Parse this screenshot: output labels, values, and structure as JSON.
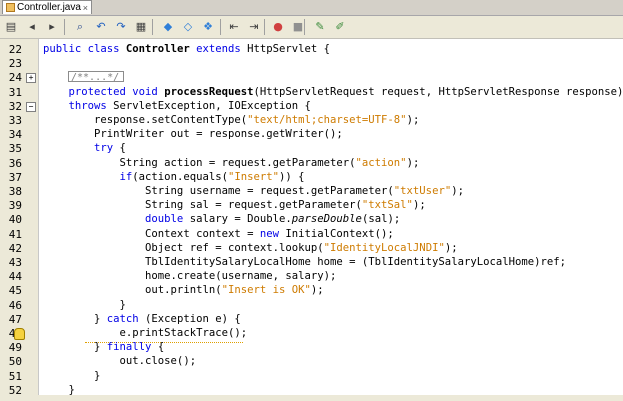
{
  "tab": {
    "title": "Controller.java",
    "close": "×"
  },
  "toolbar": {
    "icons": [
      "history-icon",
      "back-icon",
      "forward-icon",
      "search-icon",
      "find-previous-icon",
      "find-next-icon",
      "toggle-highlight-icon",
      "prev-bookmark-icon",
      "next-bookmark-icon",
      "toggle-bookmark-icon",
      "shift-left-icon",
      "shift-right-icon",
      "record-macro-icon",
      "stop-macro-icon",
      "comment-icon",
      "uncomment-icon"
    ]
  },
  "editor": {
    "line_numbers": [
      "22",
      "23",
      "24",
      "31",
      "32",
      "33",
      "34",
      "35",
      "36",
      "37",
      "38",
      "39",
      "40",
      "41",
      "42",
      "43",
      "44",
      "45",
      "46",
      "47",
      "48",
      "49",
      "50",
      "51",
      "52"
    ],
    "collapsed_text": "/**...*/",
    "lines": [
      [
        {
          "t": "public class ",
          "c": "kw"
        },
        {
          "t": "Controller",
          "c": "b"
        },
        {
          "t": " ",
          "c": ""
        },
        {
          "t": "extends",
          "c": "kw"
        },
        {
          "t": " HttpServlet {",
          "c": ""
        }
      ],
      [],
      [],
      [
        {
          "t": "    protected void ",
          "c": "kw"
        },
        {
          "t": "processRequest",
          "c": "b"
        },
        {
          "t": "(HttpServletRequest request, HttpServletResponse response)",
          "c": ""
        }
      ],
      [
        {
          "t": "    throws",
          "c": "kw"
        },
        {
          "t": " ServletException, IOException {",
          "c": ""
        }
      ],
      [
        {
          "t": "        response.setContentType(",
          "c": ""
        },
        {
          "t": "\"text/html;charset=UTF-8\"",
          "c": "st"
        },
        {
          "t": ");",
          "c": ""
        }
      ],
      [
        {
          "t": "        PrintWriter out = response.getWriter();",
          "c": ""
        }
      ],
      [
        {
          "t": "        try",
          "c": "kw"
        },
        {
          "t": " {",
          "c": ""
        }
      ],
      [
        {
          "t": "            String action = request.getParameter(",
          "c": ""
        },
        {
          "t": "\"action\"",
          "c": "st"
        },
        {
          "t": ");",
          "c": ""
        }
      ],
      [
        {
          "t": "            if",
          "c": "kw"
        },
        {
          "t": "(action.equals(",
          "c": ""
        },
        {
          "t": "\"Insert\"",
          "c": "st"
        },
        {
          "t": ")) {",
          "c": ""
        }
      ],
      [
        {
          "t": "                String username = request.getParameter(",
          "c": ""
        },
        {
          "t": "\"txtUser\"",
          "c": "st"
        },
        {
          "t": ");",
          "c": ""
        }
      ],
      [
        {
          "t": "                String sal = request.getParameter(",
          "c": ""
        },
        {
          "t": "\"txtSal\"",
          "c": "st"
        },
        {
          "t": ");",
          "c": ""
        }
      ],
      [
        {
          "t": "                double",
          "c": "kw"
        },
        {
          "t": " salary = Double.",
          "c": ""
        },
        {
          "t": "parseDouble",
          "c": "it"
        },
        {
          "t": "(sal);",
          "c": ""
        }
      ],
      [
        {
          "t": "                Context context = ",
          "c": ""
        },
        {
          "t": "new",
          "c": "kw"
        },
        {
          "t": " InitialContext();",
          "c": ""
        }
      ],
      [
        {
          "t": "                Object ref = context.lookup(",
          "c": ""
        },
        {
          "t": "\"IdentityLocalJNDI\"",
          "c": "st"
        },
        {
          "t": ");",
          "c": ""
        }
      ],
      [
        {
          "t": "                TblIdentitySalaryLocalHome home = (TblIdentitySalaryLocalHome)ref;",
          "c": ""
        }
      ],
      [
        {
          "t": "                home.create(username, salary);",
          "c": ""
        }
      ],
      [
        {
          "t": "                out.println(",
          "c": ""
        },
        {
          "t": "\"Insert is OK\"",
          "c": "st"
        },
        {
          "t": ");",
          "c": ""
        }
      ],
      [
        {
          "t": "            }",
          "c": ""
        }
      ],
      [
        {
          "t": "        } ",
          "c": ""
        },
        {
          "t": "catch",
          "c": "kw"
        },
        {
          "t": " (Exception e) {",
          "c": ""
        }
      ],
      [
        {
          "t": "            e.printStackTrace();",
          "c": ""
        }
      ],
      [
        {
          "t": "        } ",
          "c": ""
        },
        {
          "t": "finally",
          "c": "kw"
        },
        {
          "t": " {",
          "c": ""
        }
      ],
      [
        {
          "t": "            out.close();",
          "c": ""
        }
      ],
      [
        {
          "t": "        }",
          "c": ""
        }
      ],
      [
        {
          "t": "    }",
          "c": ""
        }
      ]
    ]
  },
  "colors": {
    "keyword": "#0000e6",
    "string": "#ce7b00",
    "gutter": "#ece9d8",
    "toolbar": "#ece9d8"
  }
}
